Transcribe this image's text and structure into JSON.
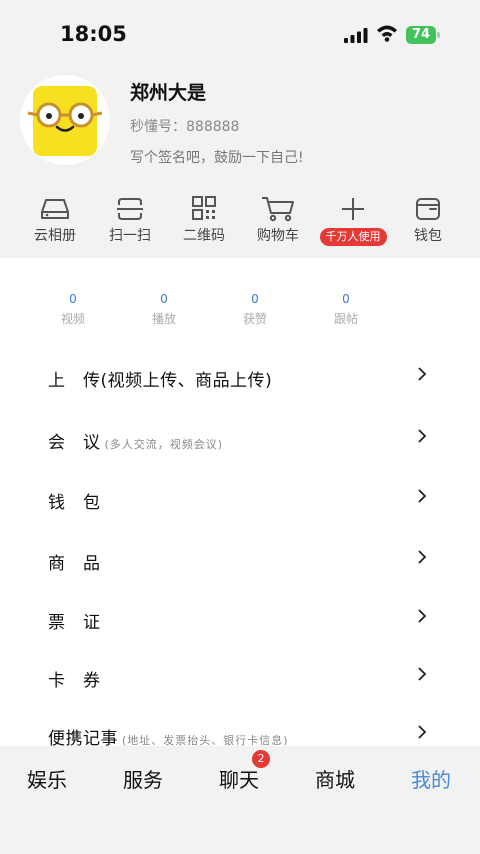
{
  "status_bar": {
    "time": "18:05",
    "battery": "74"
  },
  "profile": {
    "name": "郑州大是",
    "id_label": "秒懂号：",
    "id_value": "888888",
    "signature": "写个签名吧，鼓励一下自己!"
  },
  "tools": [
    {
      "label": "云相册",
      "icon": "cloud-album-icon"
    },
    {
      "label": "扫一扫",
      "icon": "scan-icon"
    },
    {
      "label": "二维码",
      "icon": "qr-code-icon"
    },
    {
      "label": "购物车",
      "icon": "cart-icon"
    },
    {
      "label": "千万人使用",
      "icon": "plus-icon"
    },
    {
      "label": "钱包",
      "icon": "wallet-icon"
    }
  ],
  "stats": [
    {
      "value": "0",
      "label": "视频"
    },
    {
      "value": "0",
      "label": "播放"
    },
    {
      "value": "0",
      "label": "获赞"
    },
    {
      "value": "0",
      "label": "跟帖"
    }
  ],
  "menu": [
    {
      "label": "上　传(视频上传、商品上传)",
      "sub": ""
    },
    {
      "label": "会　议",
      "sub": "(多人交流，视频会议)"
    },
    {
      "label": "钱　包",
      "sub": ""
    },
    {
      "label": "商　品",
      "sub": ""
    },
    {
      "label": "票　证",
      "sub": ""
    },
    {
      "label": "卡　券",
      "sub": ""
    },
    {
      "label": "便携记事",
      "sub": "(地址、发票抬头、银行卡信息)"
    }
  ],
  "tabs": [
    {
      "label": "娱乐"
    },
    {
      "label": "服务"
    },
    {
      "label": "聊天",
      "badge": "2"
    },
    {
      "label": "商城"
    },
    {
      "label": "我的",
      "active": true
    }
  ],
  "colors": {
    "accent": "#4a89dc",
    "badge": "#e53935",
    "avatar": "#f7e020"
  }
}
